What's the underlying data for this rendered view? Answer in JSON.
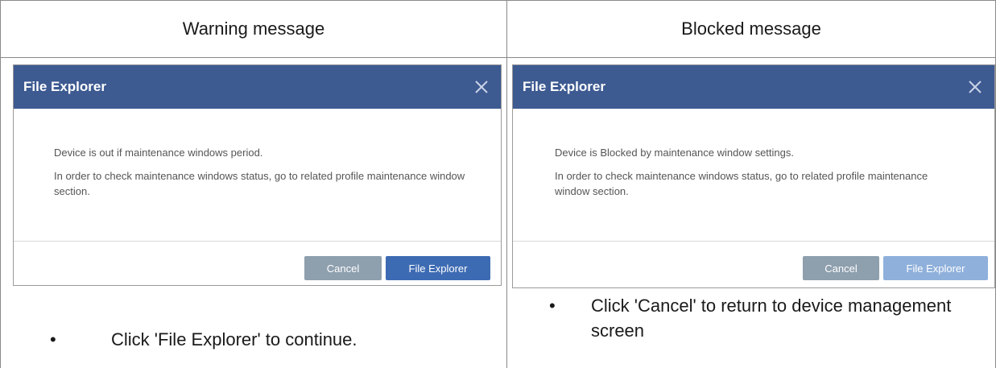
{
  "columns": {
    "left_header": "Warning message",
    "right_header": "Blocked message"
  },
  "warning_dialog": {
    "title": "File Explorer",
    "close_icon": "close-icon",
    "line1": "Device is out if maintenance windows period.",
    "line2": "In order to check maintenance windows status, go to related profile maintenance window section.",
    "cancel_label": "Cancel",
    "primary_label": "File Explorer"
  },
  "blocked_dialog": {
    "title": "File Explorer",
    "close_icon": "close-icon",
    "line1": "Device is Blocked by maintenance window settings.",
    "line2": "In order to check maintenance windows status, go to related profile maintenance window section.",
    "cancel_label": "Cancel",
    "primary_label": "File Explorer",
    "primary_state": "disabled"
  },
  "bullets": {
    "left": "Click 'File Explorer' to continue.",
    "right": "Click 'Cancel' to return to device management screen",
    "marker": "•"
  },
  "colors": {
    "titlebar": "#3d5a91",
    "cancel_button": "#8e9fae",
    "primary_button": "#3d6bb3",
    "primary_button_disabled": "#8fb0db"
  }
}
